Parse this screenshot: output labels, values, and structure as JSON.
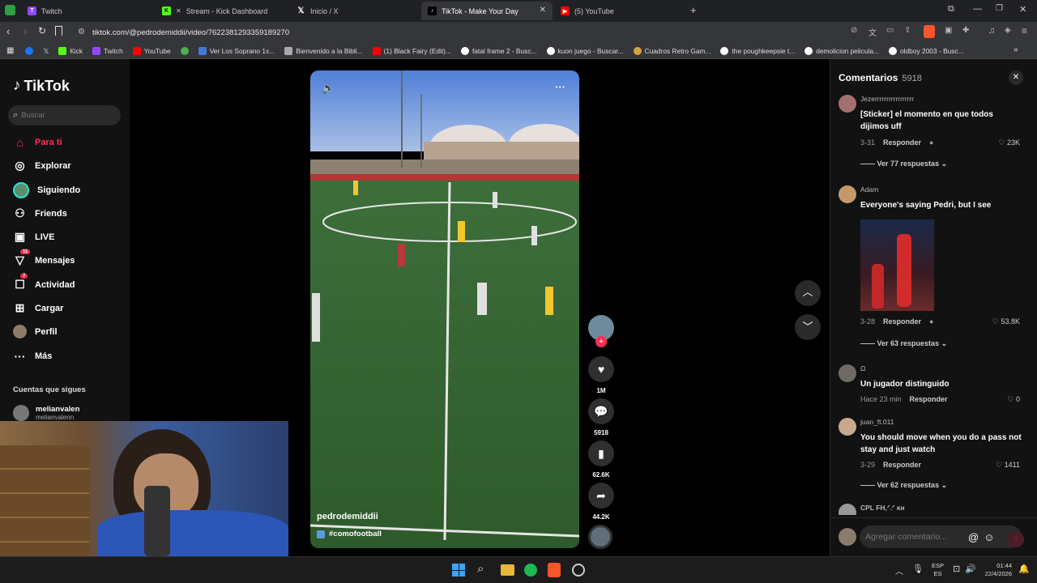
{
  "browser": {
    "tabs": [
      {
        "title": "Twitch",
        "icon": "twitch-icon",
        "color": "#9146ff"
      },
      {
        "title": "Stream - Kick Dashboard",
        "icon": "kick-icon",
        "color": "#53fc18"
      },
      {
        "title": "Inicio / X",
        "icon": "x-icon",
        "color": "#000000"
      },
      {
        "title": "TikTok - Make Your Day",
        "icon": "tiktok-icon",
        "color": "#000000"
      },
      {
        "title": "(5) YouTube",
        "icon": "youtube-icon",
        "color": "#ff0000"
      }
    ],
    "url": "tiktok.com/@pedrodemiddii/video/7622381293359189270",
    "bookmarks": [
      {
        "label": "Kick",
        "color": "#53fc18"
      },
      {
        "label": "Twitch",
        "color": "#9146ff"
      },
      {
        "label": "YouTube",
        "color": "#ff0000"
      },
      {
        "label": "",
        "color": "#4caf50"
      },
      {
        "label": "Ver Los Soprano 1x...",
        "color": "#3f7bd6"
      },
      {
        "label": "Bienvenido a la Bibli...",
        "color": "#aaaaaa"
      },
      {
        "label": "(1) Black Fairy (Edit)...",
        "color": "#ff0000"
      },
      {
        "label": "fatal frame 2 - Busc...",
        "color": "#ffffff"
      },
      {
        "label": "kuon juego - Buscar...",
        "color": "#ffffff"
      },
      {
        "label": "Cuadros Retro Gam...",
        "color": "#d6a33f"
      },
      {
        "label": "the poughkeepsie t...",
        "color": "#ffffff"
      },
      {
        "label": "demolicion pelicula...",
        "color": "#ffffff"
      },
      {
        "label": "oldboy 2003 - Busc...",
        "color": "#ffffff"
      }
    ]
  },
  "tiktok": {
    "logo": "TikTok",
    "search_placeholder": "Buscar",
    "nav": [
      {
        "label": "Para ti",
        "icon": "home-icon",
        "active": true
      },
      {
        "label": "Explorar",
        "icon": "compass-icon"
      },
      {
        "label": "Siguiendo",
        "icon": "following-avatar-icon"
      },
      {
        "label": "Friends",
        "icon": "friends-icon"
      },
      {
        "label": "LIVE",
        "icon": "live-icon"
      },
      {
        "label": "Mensajes",
        "icon": "messages-icon",
        "badge": "11"
      },
      {
        "label": "Actividad",
        "icon": "activity-icon",
        "badge": "7"
      },
      {
        "label": "Cargar",
        "icon": "upload-icon"
      },
      {
        "label": "Perfil",
        "icon": "profile-avatar-icon"
      },
      {
        "label": "Más",
        "icon": "more-dots-icon"
      }
    ],
    "following_title": "Cuentas que sigues",
    "following": [
      {
        "name": "melianvalen",
        "handle": "melianvalenn"
      }
    ],
    "video": {
      "author": "pedrodemiddii",
      "caption": "#comofootball"
    },
    "actions": {
      "likes": "1M",
      "comments": "5918",
      "saves": "62.6K",
      "shares": "44.2K"
    },
    "comments_panel": {
      "title": "Comentarios",
      "count": "5918",
      "input_placeholder": "Agregar comentario...",
      "items": [
        {
          "user": "Jezerrrrrrrrrrrrrrrrr",
          "text": "[Sticker] el momento en que todos dijimos uff",
          "date": "3-31",
          "reply": "Responder",
          "likes": "23K",
          "more": "Ver 77 respuestas"
        },
        {
          "user": "Adam",
          "text": "Everyone's saying Pedri, but I see",
          "date": "3-28",
          "reply": "Responder",
          "likes": "53.8K",
          "more": "Ver 63 respuestas"
        },
        {
          "user": "Ω",
          "text": "Un jugador distinguido",
          "date": "Hace 23 min",
          "reply": "Responder",
          "likes": "0",
          "more": ""
        },
        {
          "user": "juan_ft.011",
          "text": "You should move when you do a pass not stay and just watch",
          "date": "3-29",
          "reply": "Responder",
          "likes": "1411",
          "more": "Ver 62 respuestas"
        },
        {
          "user": "CPL FH,ᐟ.ᐟ ĸн",
          "text": "",
          "date": "",
          "reply": "",
          "likes": "",
          "more": ""
        }
      ]
    }
  },
  "taskbar": {
    "lang": "ESP",
    "lang_sub": "ES",
    "time": "01:44",
    "date": "22/4/2026"
  }
}
